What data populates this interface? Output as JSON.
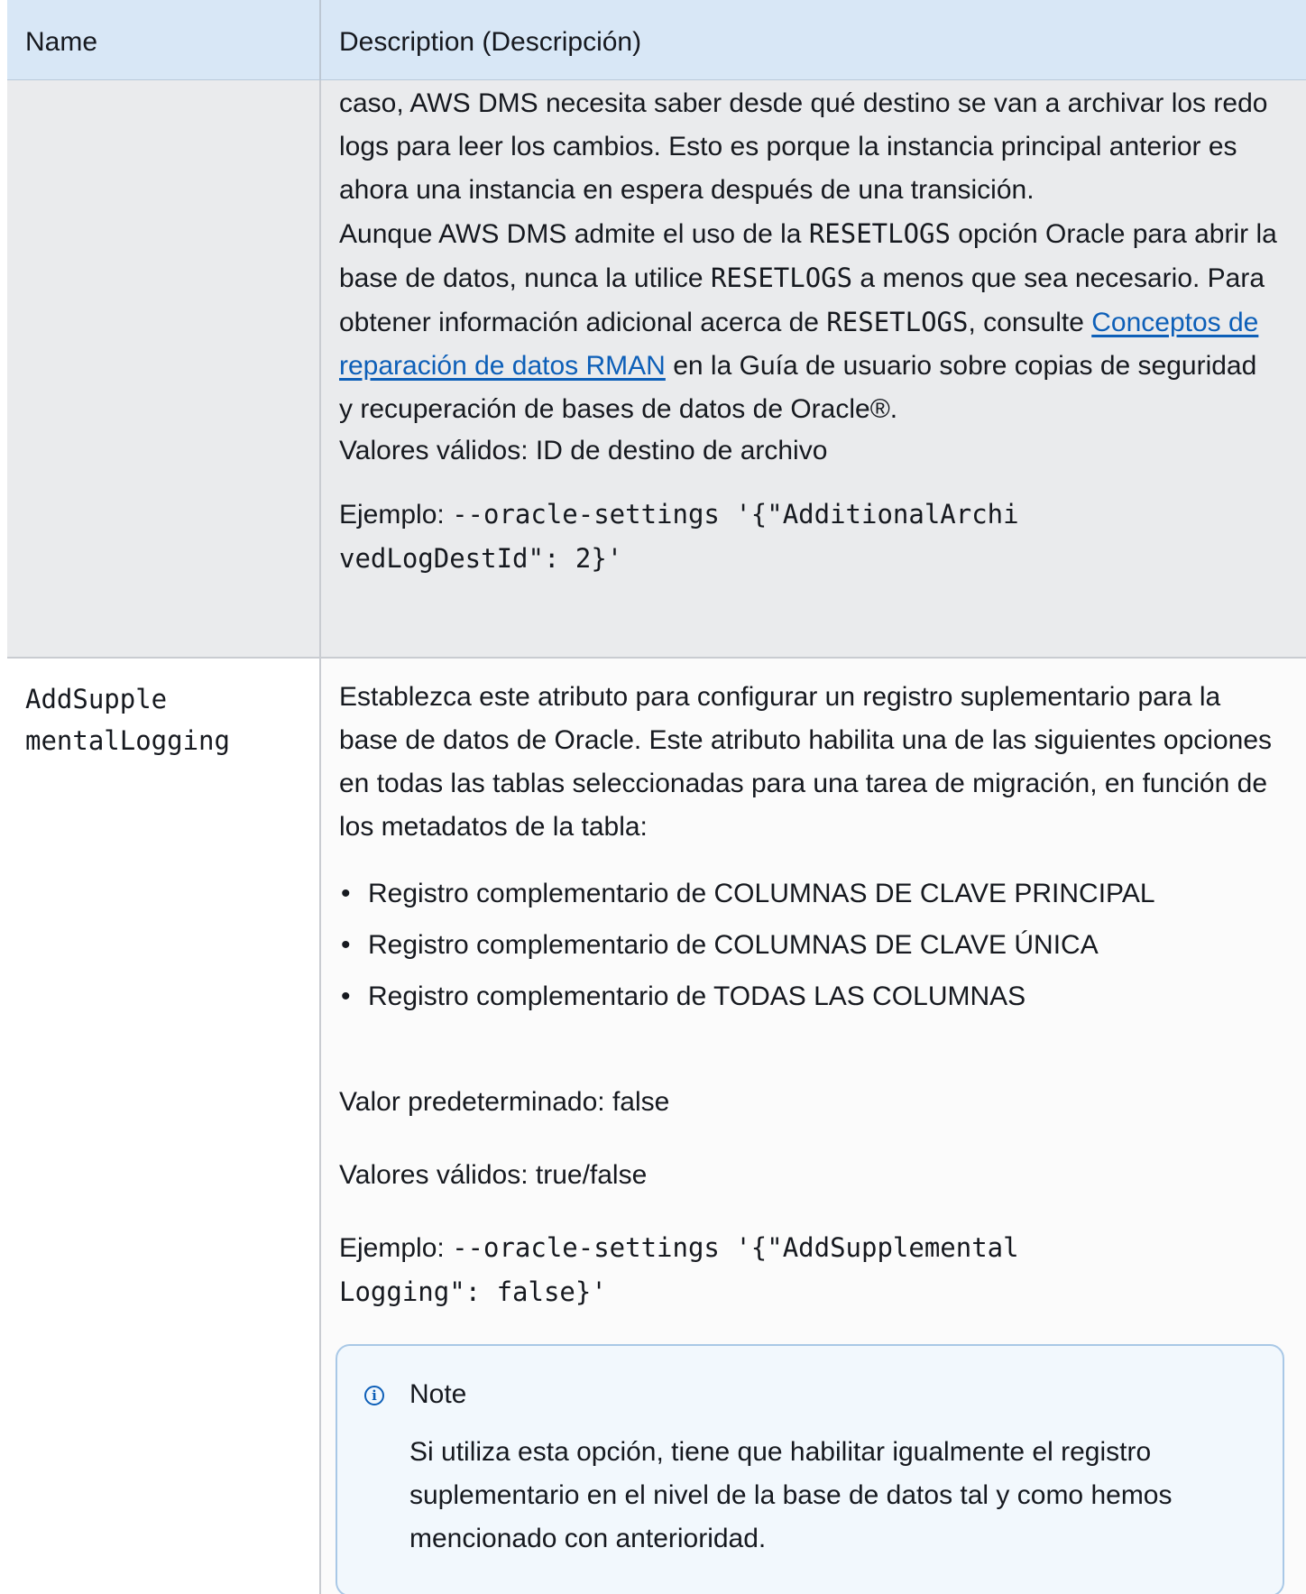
{
  "table": {
    "header": {
      "name": "Name",
      "description": "Description (Descripción)"
    },
    "row1": {
      "para1": "caso, AWS DMS necesita saber desde qué destino se van a archivar los redo logs para leer los cambios. Esto es porque la instancia principal anterior es ahora una instancia en espera después de una transición.",
      "para2": {
        "t1": "Aunque AWS DMS admite el uso de la ",
        "code1": "RESETLOGS",
        "t2": " opción Oracle para abrir la base de datos, nunca la utilice ",
        "code2": "RESETLOGS",
        "t3": " a menos que sea necesario. Para obtener información adicional acerca de ",
        "code3": "RESETLOGS",
        "t4": ", consulte ",
        "link": "Conceptos de reparación de datos RMAN",
        "t5": " en la Guía de usuario sobre copias de seguridad y recuperación de bases de datos de Oracle®."
      },
      "valid_values": "Valores válidos: ID de destino de archivo",
      "example_label": "Ejemplo: ",
      "example_code_line1": "--oracle-settings '{\"AdditionalArchi",
      "example_code_line2": "vedLogDestId\": 2}'"
    },
    "row2": {
      "name_line1": "AddSupple",
      "name_line2": "mentalLogging",
      "intro": "Establezca este atributo para configurar un registro suplementario para la base de datos de Oracle. Este atributo habilita una de las siguientes opciones en todas las tablas seleccionadas para una tarea de migración, en función de los metadatos de la tabla:",
      "bullets": [
        "Registro complementario de COLUMNAS DE CLAVE PRINCIPAL",
        "Registro complementario de COLUMNAS DE CLAVE ÚNICA",
        "Registro complementario de TODAS LAS COLUMNAS"
      ],
      "default_value": "Valor predeterminado: false",
      "valid_values": "Valores válidos: true/false",
      "example_label": "Ejemplo: ",
      "example_code_line1": "--oracle-settings '{\"AddSupplemental",
      "example_code_line2": "Logging\": false}'",
      "note": {
        "icon": "info-icon",
        "title": "Note",
        "body": "Si utiliza esta opción, tiene que habilitar igualmente el registro suplementario en el nivel de la base de datos tal y como hemos mencionado con anterioridad."
      }
    }
  },
  "colors": {
    "header_bg": "#d8e7f6",
    "row_alt_bg": "#eaebed",
    "link": "#0d5fb8",
    "note_bg": "#f2f8fd",
    "note_border": "#a9c8e6"
  }
}
